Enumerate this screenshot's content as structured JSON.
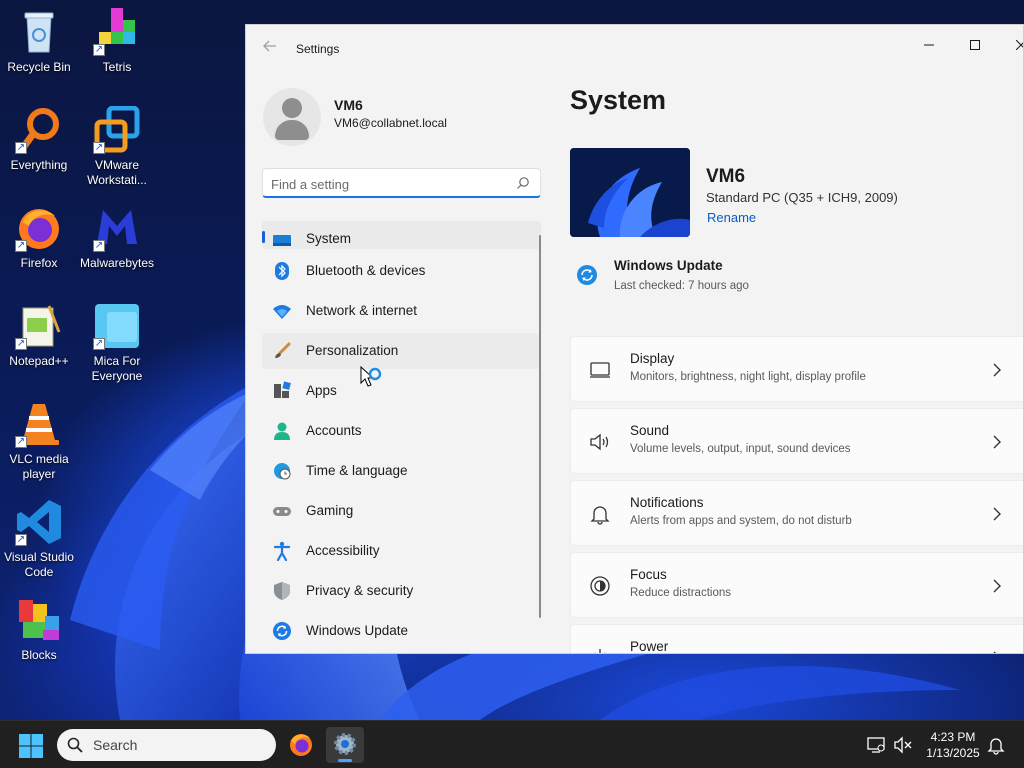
{
  "desktop": {
    "icons": [
      {
        "label": "Recycle Bin",
        "name": "recycle-bin"
      },
      {
        "label": "Tetris",
        "name": "tetris"
      },
      {
        "label": "Everything",
        "name": "everything"
      },
      {
        "label": "VMware Workstati...",
        "name": "vmware-workstation"
      },
      {
        "label": "Firefox",
        "name": "firefox"
      },
      {
        "label": "Malwarebytes",
        "name": "malwarebytes"
      },
      {
        "label": "Notepad++",
        "name": "notepad-plus-plus"
      },
      {
        "label": "Mica For Everyone",
        "name": "mica-for-everyone"
      },
      {
        "label": "VLC media player",
        "name": "vlc-media-player"
      },
      {
        "label": "Visual Studio Code",
        "name": "visual-studio-code"
      },
      {
        "label": "Blocks",
        "name": "blocks"
      }
    ]
  },
  "window": {
    "title": "Settings",
    "controls": {
      "minimize": "—",
      "maximize": "☐",
      "close": "✕"
    }
  },
  "profile": {
    "name": "VM6",
    "email": "VM6@collabnet.local"
  },
  "search": {
    "placeholder": "Find a setting"
  },
  "nav": {
    "items": [
      {
        "label": "System",
        "icon": "monitor-icon",
        "selected": true
      },
      {
        "label": "Bluetooth & devices",
        "icon": "bluetooth-icon"
      },
      {
        "label": "Network & internet",
        "icon": "wifi-icon"
      },
      {
        "label": "Personalization",
        "icon": "paintbrush-icon",
        "hover": true
      },
      {
        "label": "Apps",
        "icon": "apps-icon"
      },
      {
        "label": "Accounts",
        "icon": "person-icon"
      },
      {
        "label": "Time & language",
        "icon": "globe-clock-icon"
      },
      {
        "label": "Gaming",
        "icon": "gamepad-icon"
      },
      {
        "label": "Accessibility",
        "icon": "accessibility-icon"
      },
      {
        "label": "Privacy & security",
        "icon": "shield-icon"
      },
      {
        "label": "Windows Update",
        "icon": "update-icon"
      }
    ]
  },
  "main": {
    "title": "System",
    "device": {
      "name": "VM6",
      "model": "Standard PC (Q35 + ICH9, 2009)",
      "rename": "Rename"
    },
    "update": {
      "title": "Windows Update",
      "status": "Last checked: 7 hours ago"
    },
    "cards": [
      {
        "title": "Display",
        "subtitle": "Monitors, brightness, night light, display profile",
        "icon": "display-icon"
      },
      {
        "title": "Sound",
        "subtitle": "Volume levels, output, input, sound devices",
        "icon": "speaker-icon"
      },
      {
        "title": "Notifications",
        "subtitle": "Alerts from apps and system, do not disturb",
        "icon": "bell-icon"
      },
      {
        "title": "Focus",
        "subtitle": "Reduce distractions",
        "icon": "focus-icon"
      },
      {
        "title": "Power",
        "subtitle": "",
        "icon": "power-icon"
      }
    ]
  },
  "taskbar": {
    "search_label": "Search",
    "time": "4:23 PM",
    "date": "1/13/2025"
  },
  "colors": {
    "accent": "#1a5fd0",
    "link": "#0a5cc2",
    "window_bg": "#f3f3f3",
    "taskbar_bg": "#202020"
  }
}
